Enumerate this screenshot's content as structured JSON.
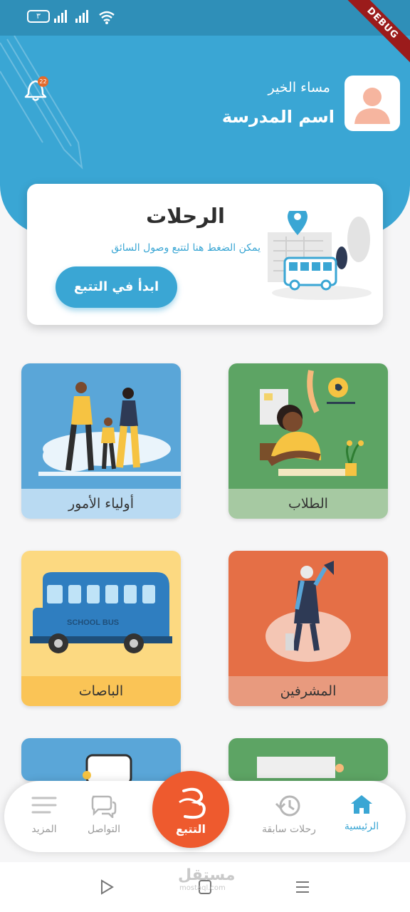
{
  "status_bar": {
    "battery": "٣",
    "debug_label": "DEBUG"
  },
  "header": {
    "greeting": "مساء الخير",
    "school_name": "اسم المدرسة",
    "notification_count": "22",
    "background_color": "#3aa6d4"
  },
  "trip_card": {
    "title": "الرحلات",
    "subtitle": "يمكن الضغط هنا لتتبع وصول السائق",
    "button_label": "ابدأ في التتبع"
  },
  "tiles": [
    {
      "label": "الطلاب",
      "art_color": "#5da464",
      "label_bg": "#a6c9a2",
      "icon": "student-raising-hand-illustration"
    },
    {
      "label": "أولياء الأمور",
      "art_color": "#5aa6d8",
      "label_bg": "#b9daf2",
      "icon": "parents-with-child-illustration"
    },
    {
      "label": "المشرفين",
      "art_color": "#e56f46",
      "label_bg": "#e89a7e",
      "icon": "supervisor-megaphone-illustration"
    },
    {
      "label": "الباصات",
      "art_color": "#fcd981",
      "label_bg": "#fac456",
      "icon": "school-bus-illustration"
    }
  ],
  "bus_text": "SCHOOL BUS",
  "bottom_nav": {
    "home": "الرئيسية",
    "past_trips": "رحلات سابقة",
    "tracking": "التتبع",
    "contact": "التواصل",
    "more": "المزيد",
    "active_color": "#3aa6d4",
    "fab_color": "#ee5a2e"
  },
  "watermark": {
    "brand": "مستقل",
    "domain": "mostaql.com"
  }
}
